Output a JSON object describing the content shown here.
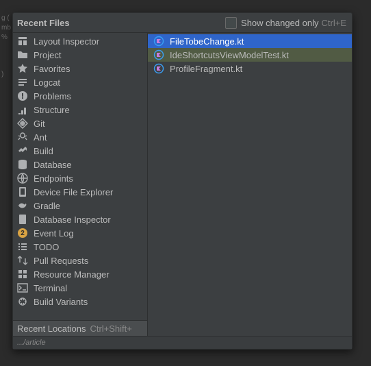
{
  "header": {
    "title": "Recent Files",
    "checkbox_label": "Show changed only",
    "checkbox_shortcut": "Ctrl+E"
  },
  "tools": [
    {
      "icon": "layout-inspector",
      "label": "Layout Inspector"
    },
    {
      "icon": "folder",
      "label": "Project"
    },
    {
      "icon": "star",
      "label": "Favorites"
    },
    {
      "icon": "logcat",
      "label": "Logcat"
    },
    {
      "icon": "problems",
      "label": "Problems"
    },
    {
      "icon": "structure",
      "label": "Structure"
    },
    {
      "icon": "git",
      "label": "Git"
    },
    {
      "icon": "ant",
      "label": "Ant"
    },
    {
      "icon": "build",
      "label": "Build"
    },
    {
      "icon": "database",
      "label": "Database"
    },
    {
      "icon": "endpoints",
      "label": "Endpoints"
    },
    {
      "icon": "device-explorer",
      "label": "Device File Explorer"
    },
    {
      "icon": "gradle",
      "label": "Gradle"
    },
    {
      "icon": "database-inspector",
      "label": "Database Inspector"
    },
    {
      "icon": "event-log",
      "label": "Event Log",
      "highlight": true,
      "badge": "2"
    },
    {
      "icon": "todo",
      "label": "TODO"
    },
    {
      "icon": "pull-requests",
      "label": "Pull Requests"
    },
    {
      "icon": "resource-manager",
      "label": "Resource Manager"
    },
    {
      "icon": "terminal",
      "label": "Terminal"
    },
    {
      "icon": "build-variants",
      "label": "Build Variants"
    }
  ],
  "recent_locations": {
    "label": "Recent Locations",
    "shortcut": "Ctrl+Shift+"
  },
  "files": [
    {
      "name": "FileTobeChange.kt",
      "state": "selected"
    },
    {
      "name": "IdeShortcutsViewModelTest.kt",
      "state": "hover2"
    },
    {
      "name": "ProfileFragment.kt",
      "state": "normal"
    }
  ],
  "footer": {
    "path": ".../article"
  },
  "bg_hints": [
    "g (",
    "mb",
    "%"
  ]
}
